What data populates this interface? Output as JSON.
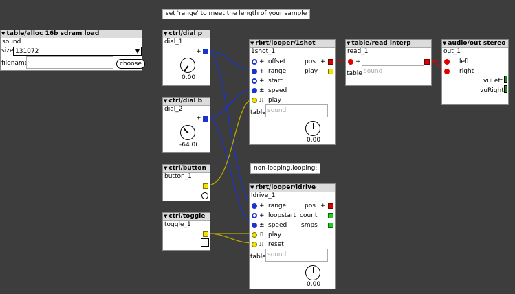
{
  "comments": {
    "c1": "set 'range' to meet the length of your sample",
    "c2": "non-looping,looping:"
  },
  "alloc": {
    "header": "table/alloc 16b sdram load",
    "instance": "sound",
    "size_label": "size",
    "size_value": "131072",
    "filename_label": "filename",
    "choose_label": "choose"
  },
  "dial_p": {
    "header": "ctrl/dial p",
    "instance": "dial_1",
    "sign": "+",
    "value": "0.00",
    "value_norm": 0.0
  },
  "dial_b": {
    "header": "ctrl/dial b",
    "instance": "dial_2",
    "sign": "±",
    "value": "-64.0(",
    "value_norm": 0.0
  },
  "button": {
    "header": "ctrl/button",
    "instance": "button_1"
  },
  "toggle": {
    "header": "ctrl/toggle",
    "instance": "toggle_1"
  },
  "oneshot": {
    "header": "rbrt/looper/1shot",
    "instance": "1shot_1",
    "inlets": [
      "offset",
      "range",
      "start",
      "speed",
      "play"
    ],
    "inlet_signs": [
      "+",
      "+",
      "+",
      "±",
      "⎍"
    ],
    "outlets": [
      "pos",
      "play"
    ],
    "outlet_signs": [
      "+",
      ""
    ],
    "table_label": "table",
    "table_placeholder": "sound",
    "knob_value": "0.00"
  },
  "ldrive": {
    "header": "rbrt/looper/ldrive",
    "instance": "ldrive_1",
    "inlets": [
      "range",
      "loopstart",
      "speed",
      "play",
      "reset"
    ],
    "inlet_signs": [
      "+",
      "+",
      "±",
      "⎍",
      "⎍"
    ],
    "outlets": [
      "pos",
      "count",
      "smps"
    ],
    "table_label": "table",
    "table_placeholder": "sound",
    "knob_value": "0.00"
  },
  "readinterp": {
    "header": "table/read interp",
    "instance": "read_1",
    "inlet_sign": "+",
    "table_label": "table",
    "table_placeholder": "sound"
  },
  "audioout": {
    "header": "audio/out stereo",
    "instance": "out_1",
    "inlets": [
      "left",
      "right"
    ],
    "vu": [
      "vuLeft",
      "vuRight"
    ]
  },
  "colors": {
    "background": "#3d3d3d",
    "frac": "#1a33cc",
    "bool": "#f2e200",
    "audio": "#e00000",
    "int": "#22cc22"
  }
}
